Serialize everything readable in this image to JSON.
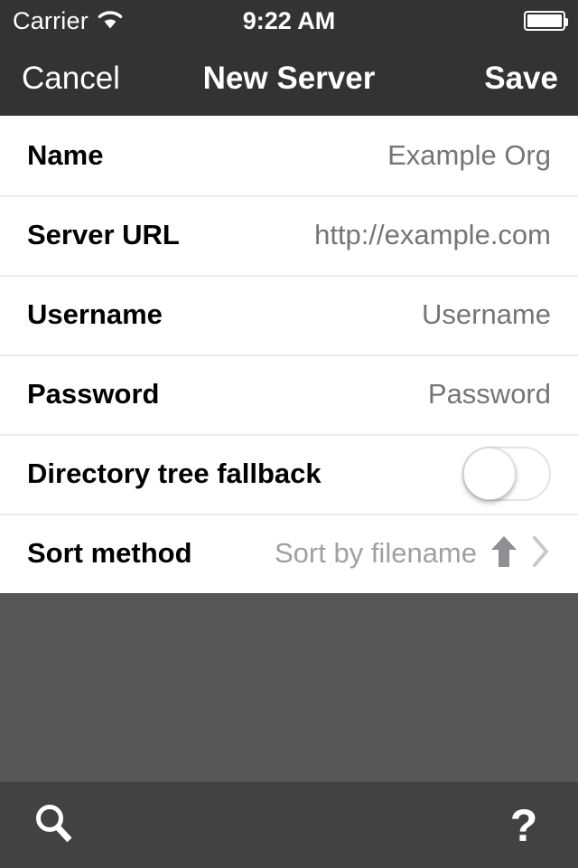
{
  "status_bar": {
    "carrier": "Carrier",
    "wifi_icon": "wifi-icon",
    "time": "9:22 AM",
    "battery_icon": "battery-full-icon"
  },
  "nav_bar": {
    "cancel_label": "Cancel",
    "title": "New Server",
    "save_label": "Save"
  },
  "form": {
    "rows": [
      {
        "label": "Name",
        "placeholder": "Example Org",
        "type": "text"
      },
      {
        "label": "Server URL",
        "placeholder": "http://example.com",
        "type": "text"
      },
      {
        "label": "Username",
        "placeholder": "Username",
        "type": "text"
      },
      {
        "label": "Password",
        "placeholder": "Password",
        "type": "password"
      },
      {
        "label": "Directory tree fallback",
        "type": "switch",
        "value": "off"
      },
      {
        "label": "Sort method",
        "type": "disclosure",
        "value": "Sort by filename",
        "accessory_icon": "arrow-up-icon",
        "disclosure_icon": "chevron-right-icon"
      }
    ]
  },
  "toolbar": {
    "search_icon": "search-icon",
    "help_label": "?",
    "help_icon": "help-icon"
  },
  "colors": {
    "navbar_bg": "#333333",
    "toolbar_bg": "#424242",
    "empty_bg": "#575757",
    "row_bg": "#ffffff",
    "separator": "#ececec",
    "label_text": "#000000",
    "placeholder_text": "#c4c6cb",
    "value_text": "#a0a0a0"
  }
}
